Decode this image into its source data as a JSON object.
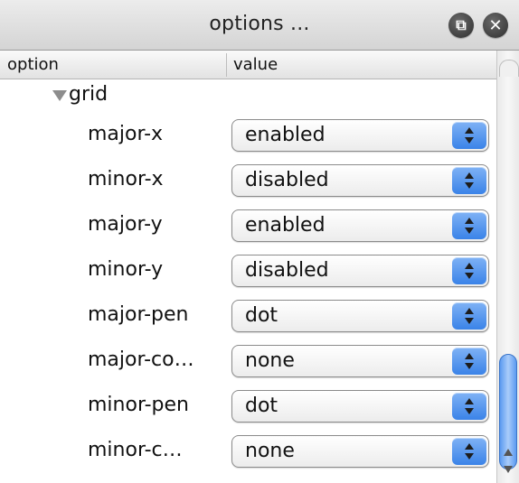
{
  "window": {
    "title": "options ...",
    "restore_icon": "restore-icon",
    "close_icon": "close-icon"
  },
  "header": {
    "col_option": "option",
    "col_value": "value"
  },
  "group": {
    "label": "grid",
    "expanded": true
  },
  "rows": [
    {
      "label": "major-x",
      "value": "enabled"
    },
    {
      "label": "minor-x",
      "value": "disabled"
    },
    {
      "label": "major-y",
      "value": "enabled"
    },
    {
      "label": "minor-y",
      "value": "disabled"
    },
    {
      "label": "major-pen",
      "value": "dot"
    },
    {
      "label": "major-co…",
      "value": "none"
    },
    {
      "label": "minor-pen",
      "value": "dot"
    },
    {
      "label": "minor-c…",
      "value": "none"
    }
  ],
  "colors": {
    "stepper_accent": "#3a83e8",
    "scroll_thumb": "#5b9af0"
  }
}
